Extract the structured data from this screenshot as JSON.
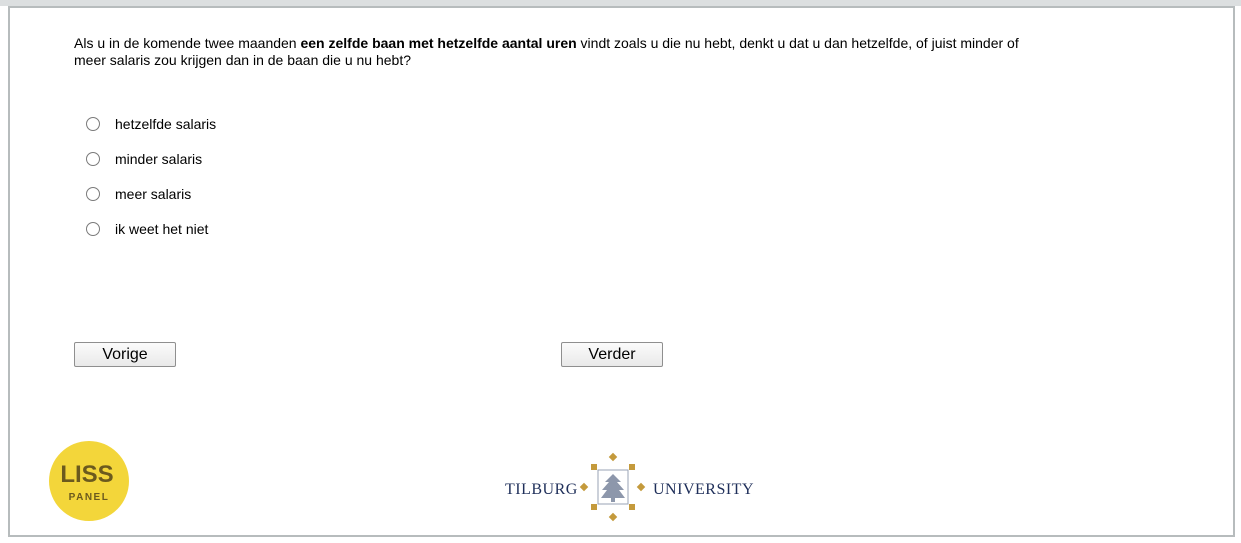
{
  "question": {
    "text_before": "Als u in de komende twee maanden ",
    "text_bold": "een zelfde baan met hetzelfde aantal uren",
    "text_after": " vindt zoals u die nu hebt, denkt u dat u dan hetzelfde, of juist minder of meer salaris zou krijgen dan in de baan die u nu hebt?"
  },
  "options": [
    {
      "label": "hetzelfde salaris",
      "selected": false
    },
    {
      "label": "minder salaris",
      "selected": false
    },
    {
      "label": "meer salaris",
      "selected": false
    },
    {
      "label": "ik weet het niet",
      "selected": false
    }
  ],
  "buttons": {
    "prev_label": "Vorige",
    "next_label": "Verder"
  },
  "logos": {
    "liss_line1": "LISS",
    "liss_line2": "PANEL",
    "tilburg_left": "TILBURG",
    "tilburg_right": "UNIVERSITY"
  },
  "colors": {
    "liss_yellow": "#f3d63a",
    "tilburg_navy": "#1f2f5a",
    "tilburg_gold": "#c49a3c"
  }
}
